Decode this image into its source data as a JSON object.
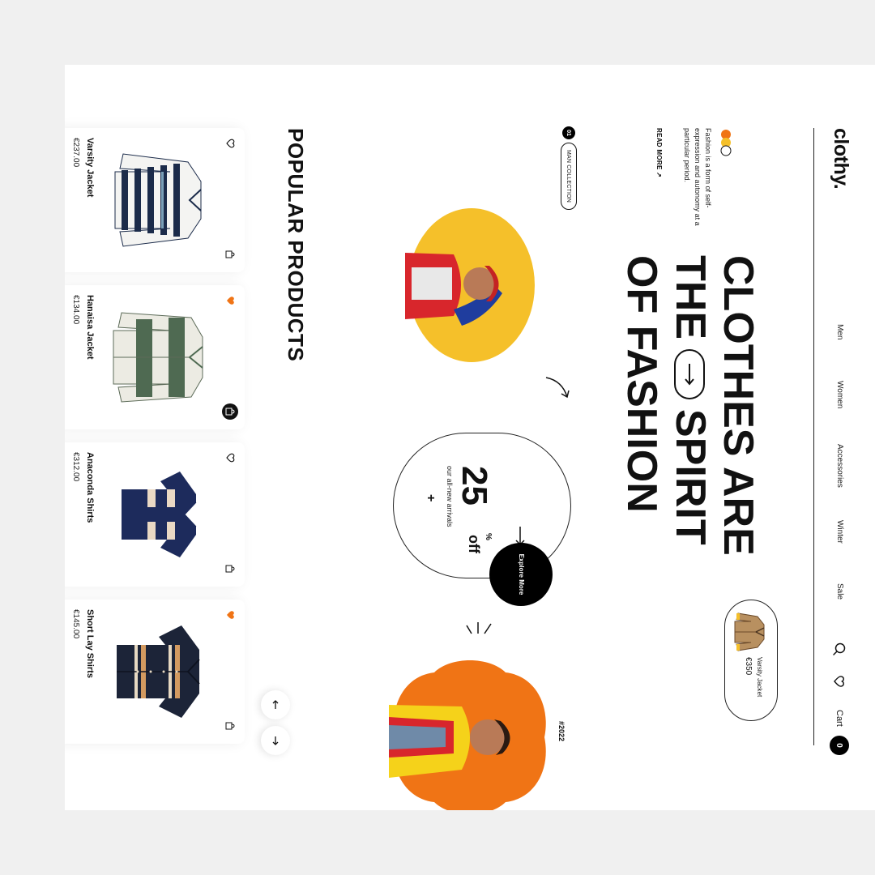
{
  "brand": {
    "logo": "clothy."
  },
  "nav": {
    "links": [
      "Men",
      "Women",
      "Accessories",
      "Winter",
      "Sale"
    ],
    "cart_label": "Cart",
    "cart_count": "0"
  },
  "hero": {
    "headline_lines": [
      "CLOTHES ARE",
      "THE",
      "SPIRIT",
      "OF FASHION"
    ],
    "description": "Fashion is a form of self-expression and autonomy at a particular period.",
    "read_more": "READ MORE ↗",
    "featured_product": {
      "name": "Varsity Jacket",
      "price": "€350"
    },
    "collection_number": "01",
    "collection_label": "MAN COLLECTION",
    "discount": {
      "value": "25",
      "percent": "%",
      "off": "off",
      "subtitle": "our all-new arrivals",
      "plus": "+"
    },
    "explore_label": "Explore More",
    "year_tag": "#2022"
  },
  "popular": {
    "title": "POPULAR PRODUCTS",
    "products": [
      {
        "name": "Varsity Jacket",
        "price": "€237.00",
        "fav_active": false,
        "bag_active": false
      },
      {
        "name": "Hanaisa Jacket",
        "price": "€134.00",
        "fav_active": true,
        "bag_active": true
      },
      {
        "name": "Anaconda Shirts",
        "price": "€312.00",
        "fav_active": false,
        "bag_active": false
      },
      {
        "name": "Short Lay Shirts",
        "price": "€145.00",
        "fav_active": true,
        "bag_active": false
      }
    ]
  },
  "colors": {
    "accent_orange": "#f07415",
    "accent_yellow": "#f5c02a",
    "dark": "#111111"
  },
  "icons": [
    "search-icon",
    "heart-icon",
    "arrow-right-icon",
    "arrow-up-icon",
    "arrow-down-icon",
    "heart-outline-icon",
    "bag-icon",
    "plus-icon"
  ]
}
